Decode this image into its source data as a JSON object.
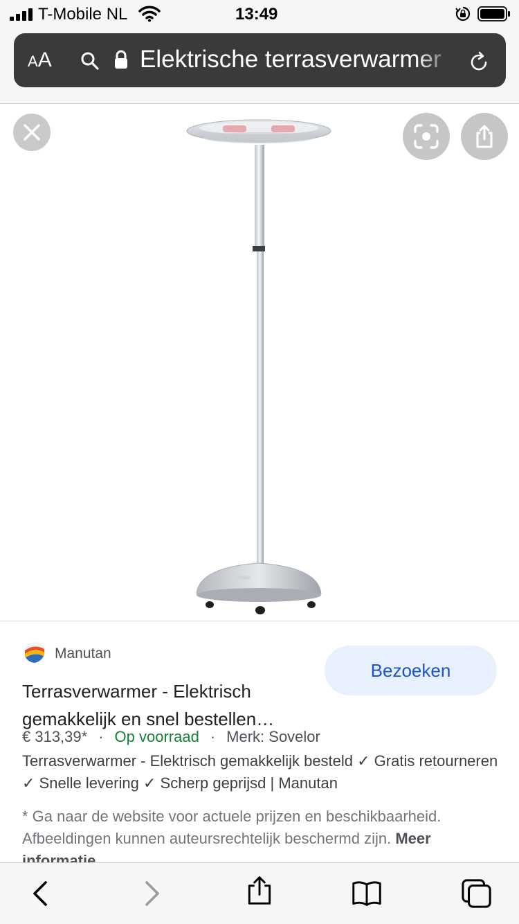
{
  "status_bar": {
    "carrier": "T-Mobile NL",
    "time": "13:49"
  },
  "url_bar": {
    "text_size_small": "A",
    "text_size_large": "A",
    "url_text": "Elektrische terrasverwarmer"
  },
  "result": {
    "source": "Manutan",
    "visit_label": "Bezoeken",
    "title": "Terrasverwarmer - Elektrisch gemakkelijk en snel bestellen…",
    "price": "€ 313,39*",
    "separator": "·",
    "stock": "Op voorraad",
    "brand": "Merk: Sovelor",
    "description": "Terrasverwarmer - Elektrisch gemakkelijk besteld ✓ Gratis retourneren ✓ Snelle levering ✓ Scherp geprijsd | Manutan",
    "disclaimer": "* Ga naar de website voor actuele prijzen en beschikbaarheid. Afbeeldingen kunnen auteursrechtelijk beschermd zijn.",
    "more_info": "Meer informatie"
  },
  "icons": [
    "signal-icon",
    "wifi-icon",
    "rotation-lock-icon",
    "battery-icon",
    "search-icon",
    "lock-icon",
    "reload-icon",
    "close-icon",
    "lens-icon",
    "share-icon",
    "back-icon",
    "forward-icon",
    "bookmarks-icon",
    "tabs-icon"
  ],
  "colors": {
    "stock_green": "#188038",
    "visit_button_bg": "#e8f0fe",
    "visit_button_text": "#1a56c4",
    "url_bar_bg": "#3a3a3c"
  }
}
